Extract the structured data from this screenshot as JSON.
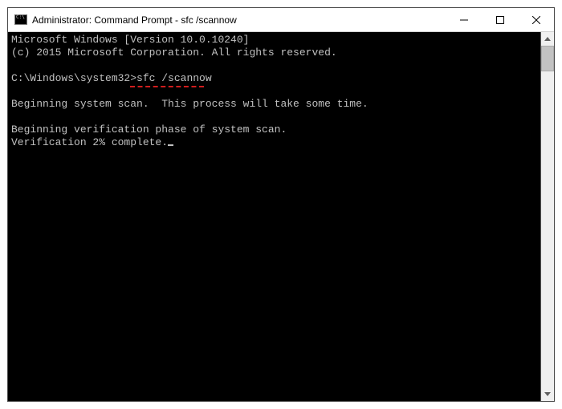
{
  "titlebar": {
    "title": "Administrator: Command Prompt - sfc  /scannow"
  },
  "terminal": {
    "line1": "Microsoft Windows [Version 10.0.10240]",
    "line2": "(c) 2015 Microsoft Corporation. All rights reserved.",
    "blank1": "",
    "prompt": "C:\\Windows\\system32>",
    "command": "sfc /scannow",
    "blank2": "",
    "line4": "Beginning system scan.  This process will take some time.",
    "blank3": "",
    "line5": "Beginning verification phase of system scan.",
    "line6": "Verification 2% complete."
  }
}
